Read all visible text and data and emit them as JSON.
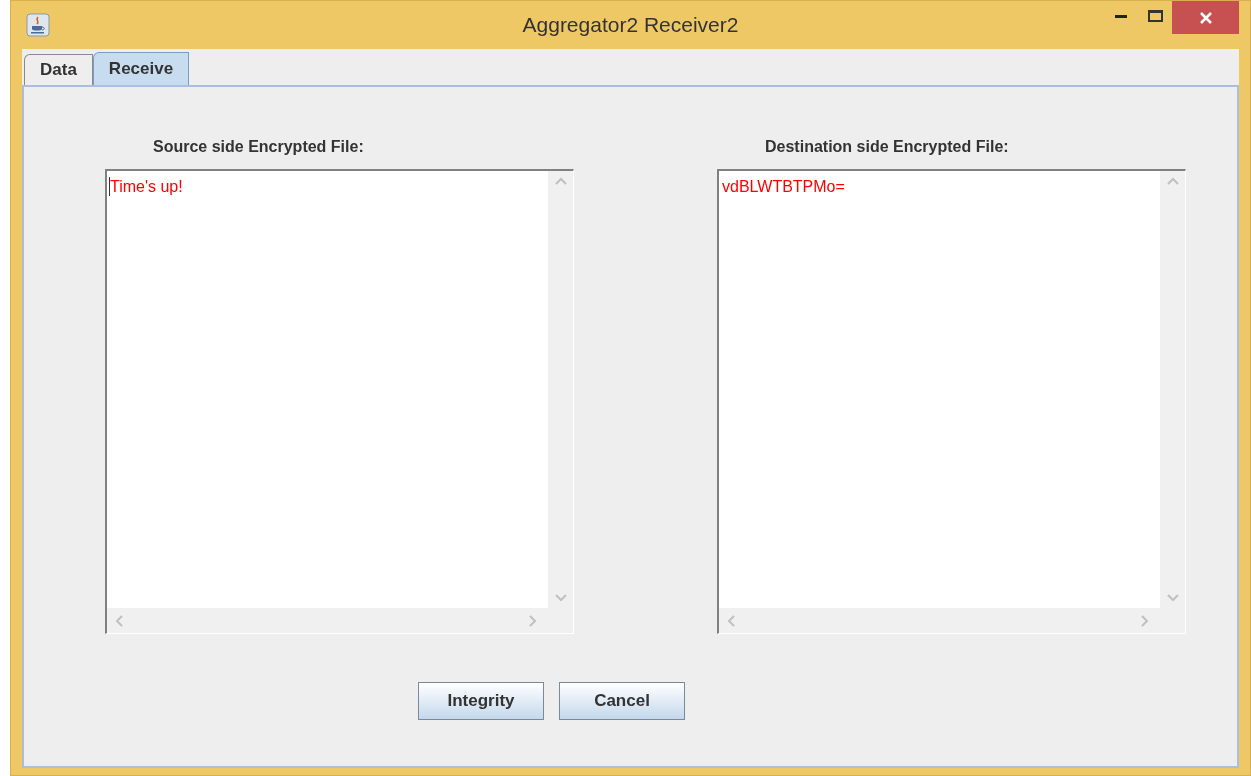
{
  "window": {
    "title": "Aggregator2 Receiver2"
  },
  "tabs": [
    {
      "label": "Data",
      "selected": false
    },
    {
      "label": "Receive",
      "selected": true
    }
  ],
  "panels": [
    {
      "label": "Source side Encrypted File:",
      "text": "Time's up!",
      "focused": true
    },
    {
      "label": "Destination side Encrypted File:",
      "text": "vdBLWTBTPMo=",
      "focused": false
    }
  ],
  "buttons": [
    "Integrity",
    "Cancel"
  ]
}
